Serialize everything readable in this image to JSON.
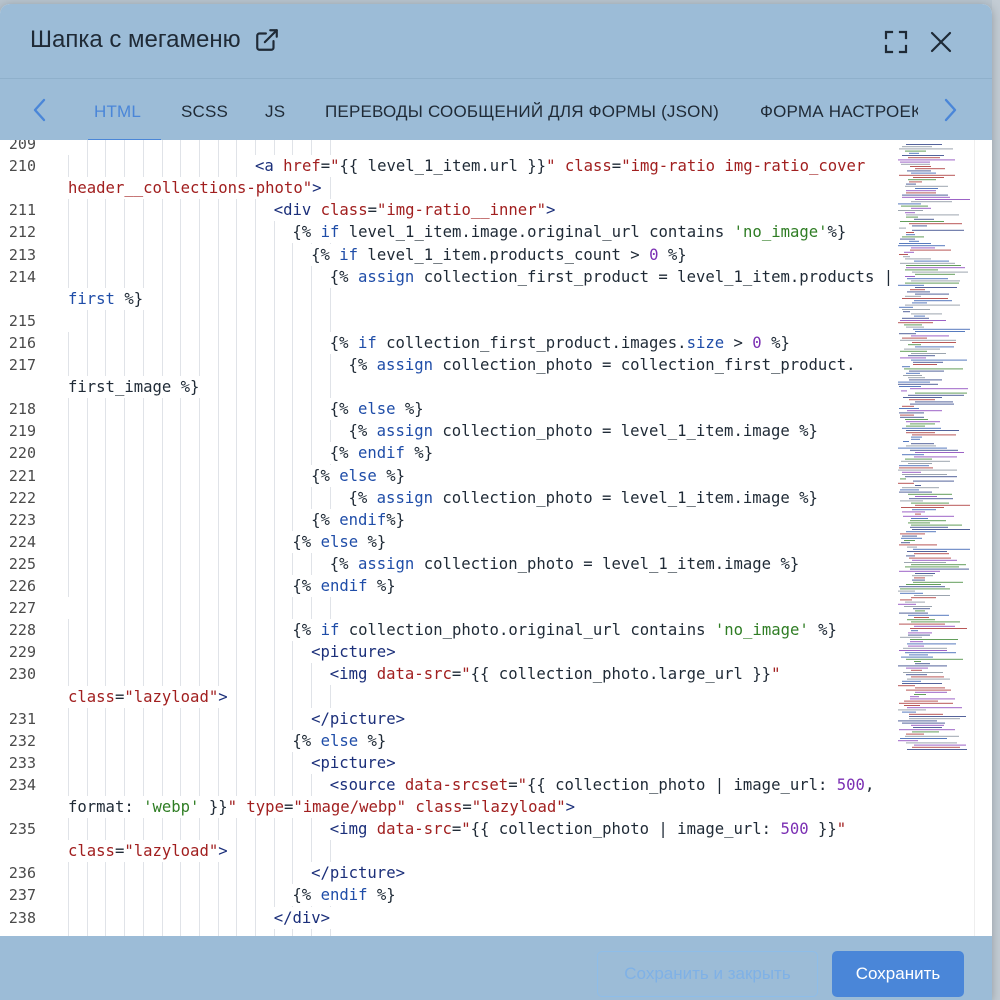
{
  "modal": {
    "title": "Шапка с мегаменю"
  },
  "tabs": [
    {
      "label": "HTML",
      "active": true
    },
    {
      "label": "SCSS",
      "active": false
    },
    {
      "label": "JS",
      "active": false
    },
    {
      "label": "ПЕРЕВОДЫ СООБЩЕНИЙ ДЛЯ ФОРМЫ (JSON)",
      "active": false
    },
    {
      "label": "ФОРМА НАСТРОЕК",
      "active": false
    }
  ],
  "colors": {
    "header_bg": "#9cbcd7",
    "accent": "#4a86d8",
    "tag": "#1b2f7a",
    "string": "#a11f1f",
    "keyword": "#1f4da8",
    "number": "#7b2fb3",
    "single_quote_string": "#2f7d24"
  },
  "icons": {
    "external": "external-link-icon",
    "fullscreen": "fullscreen-icon",
    "close": "close-icon",
    "prev": "chevron-left-icon",
    "next": "chevron-right-icon"
  },
  "editor": {
    "lines": [
      {
        "n": "209",
        "indent": 0,
        "tokens": []
      },
      {
        "n": "210",
        "indent": 10,
        "tokens": [
          [
            "tag",
            "<a"
          ],
          [
            "p",
            " "
          ],
          [
            "attr",
            "href"
          ],
          [
            "p",
            "="
          ],
          [
            "str",
            "\""
          ],
          [
            "p",
            "{{ level_1_item.url }}"
          ],
          [
            "str",
            "\""
          ],
          [
            "p",
            " "
          ],
          [
            "attr",
            "class"
          ],
          [
            "p",
            "="
          ],
          [
            "str",
            "\"img-ratio img-ratio_cover"
          ]
        ]
      },
      {
        "n": "",
        "indent": 0,
        "tokens": [
          [
            "str",
            "header__collections-photo\""
          ],
          [
            "tag",
            ">"
          ]
        ]
      },
      {
        "n": "211",
        "indent": 11,
        "tokens": [
          [
            "tag",
            "<div"
          ],
          [
            "p",
            " "
          ],
          [
            "attr",
            "class"
          ],
          [
            "p",
            "="
          ],
          [
            "str",
            "\"img-ratio__inner\""
          ],
          [
            "tag",
            ">"
          ]
        ]
      },
      {
        "n": "212",
        "indent": 12,
        "tokens": [
          [
            "p",
            "{%"
          ],
          [
            "p",
            " "
          ],
          [
            "kw",
            "if"
          ],
          [
            "p",
            " level_1_item.image.original_url contains "
          ],
          [
            "sq",
            "'no_image'"
          ],
          [
            "p",
            "%}"
          ]
        ]
      },
      {
        "n": "213",
        "indent": 13,
        "tokens": [
          [
            "p",
            "{%"
          ],
          [
            "p",
            " "
          ],
          [
            "kw",
            "if"
          ],
          [
            "p",
            " level_1_item.products_count > "
          ],
          [
            "num",
            "0"
          ],
          [
            "p",
            " %}"
          ]
        ]
      },
      {
        "n": "214",
        "indent": 14,
        "tokens": [
          [
            "p",
            "{%"
          ],
          [
            "p",
            " "
          ],
          [
            "kw",
            "assign"
          ],
          [
            "p",
            " collection_first_product = level_1_item.products |"
          ]
        ]
      },
      {
        "n": "",
        "indent": 0,
        "tokens": [
          [
            "kw",
            "first"
          ],
          [
            "p",
            " %}"
          ]
        ]
      },
      {
        "n": "215",
        "indent": 0,
        "tokens": []
      },
      {
        "n": "216",
        "indent": 14,
        "tokens": [
          [
            "p",
            "{%"
          ],
          [
            "p",
            " "
          ],
          [
            "kw",
            "if"
          ],
          [
            "p",
            " collection_first_product.images."
          ],
          [
            "kw",
            "size"
          ],
          [
            "p",
            " > "
          ],
          [
            "num",
            "0"
          ],
          [
            "p",
            " %}"
          ]
        ]
      },
      {
        "n": "217",
        "indent": 15,
        "tokens": [
          [
            "p",
            "{%"
          ],
          [
            "p",
            " "
          ],
          [
            "kw",
            "assign"
          ],
          [
            "p",
            " collection_photo = collection_first_product."
          ]
        ]
      },
      {
        "n": "",
        "indent": 0,
        "tokens": [
          [
            "p",
            "first_image %}"
          ]
        ]
      },
      {
        "n": "218",
        "indent": 14,
        "tokens": [
          [
            "p",
            "{%"
          ],
          [
            "p",
            " "
          ],
          [
            "kw",
            "else"
          ],
          [
            "p",
            " %}"
          ]
        ]
      },
      {
        "n": "219",
        "indent": 15,
        "tokens": [
          [
            "p",
            "{%"
          ],
          [
            "p",
            " "
          ],
          [
            "kw",
            "assign"
          ],
          [
            "p",
            " collection_photo = level_1_item.image %}"
          ]
        ]
      },
      {
        "n": "220",
        "indent": 14,
        "tokens": [
          [
            "p",
            "{%"
          ],
          [
            "p",
            " "
          ],
          [
            "kw",
            "endif"
          ],
          [
            "p",
            " %}"
          ]
        ]
      },
      {
        "n": "221",
        "indent": 13,
        "tokens": [
          [
            "p",
            "{%"
          ],
          [
            "p",
            " "
          ],
          [
            "kw",
            "else"
          ],
          [
            "p",
            " %}"
          ]
        ]
      },
      {
        "n": "222",
        "indent": 15,
        "tokens": [
          [
            "p",
            "{%"
          ],
          [
            "p",
            " "
          ],
          [
            "kw",
            "assign"
          ],
          [
            "p",
            " collection_photo = level_1_item.image %}"
          ]
        ]
      },
      {
        "n": "223",
        "indent": 13,
        "tokens": [
          [
            "p",
            "{%"
          ],
          [
            "p",
            " "
          ],
          [
            "kw",
            "endif"
          ],
          [
            "p",
            "%}"
          ]
        ]
      },
      {
        "n": "224",
        "indent": 12,
        "tokens": [
          [
            "p",
            "{%"
          ],
          [
            "p",
            " "
          ],
          [
            "kw",
            "else"
          ],
          [
            "p",
            " %}"
          ]
        ]
      },
      {
        "n": "225",
        "indent": 14,
        "tokens": [
          [
            "p",
            "{%"
          ],
          [
            "p",
            " "
          ],
          [
            "kw",
            "assign"
          ],
          [
            "p",
            " collection_photo = level_1_item.image %}"
          ]
        ]
      },
      {
        "n": "226",
        "indent": 12,
        "tokens": [
          [
            "p",
            "{%"
          ],
          [
            "p",
            " "
          ],
          [
            "kw",
            "endif"
          ],
          [
            "p",
            " %}"
          ]
        ]
      },
      {
        "n": "227",
        "indent": 0,
        "tokens": []
      },
      {
        "n": "228",
        "indent": 12,
        "tokens": [
          [
            "p",
            "{%"
          ],
          [
            "p",
            " "
          ],
          [
            "kw",
            "if"
          ],
          [
            "p",
            " collection_photo.original_url contains "
          ],
          [
            "sq",
            "'no_image'"
          ],
          [
            "p",
            " %}"
          ]
        ]
      },
      {
        "n": "229",
        "indent": 13,
        "tokens": [
          [
            "tag",
            "<picture>"
          ]
        ]
      },
      {
        "n": "230",
        "indent": 14,
        "tokens": [
          [
            "tag",
            "<img"
          ],
          [
            "p",
            " "
          ],
          [
            "attr",
            "data-src"
          ],
          [
            "p",
            "="
          ],
          [
            "str",
            "\""
          ],
          [
            "p",
            "{{ collection_photo.large_url }}"
          ],
          [
            "str",
            "\""
          ]
        ]
      },
      {
        "n": "",
        "indent": 0,
        "tokens": [
          [
            "attr",
            "class"
          ],
          [
            "p",
            "="
          ],
          [
            "str",
            "\"lazyload\""
          ],
          [
            "tag",
            ">"
          ]
        ]
      },
      {
        "n": "231",
        "indent": 13,
        "tokens": [
          [
            "tag",
            "</picture>"
          ]
        ]
      },
      {
        "n": "232",
        "indent": 12,
        "tokens": [
          [
            "p",
            "{%"
          ],
          [
            "p",
            " "
          ],
          [
            "kw",
            "else"
          ],
          [
            "p",
            " %}"
          ]
        ]
      },
      {
        "n": "233",
        "indent": 13,
        "tokens": [
          [
            "tag",
            "<picture>"
          ]
        ]
      },
      {
        "n": "234",
        "indent": 14,
        "tokens": [
          [
            "tag",
            "<source"
          ],
          [
            "p",
            " "
          ],
          [
            "attr",
            "data-srcset"
          ],
          [
            "p",
            "="
          ],
          [
            "str",
            "\""
          ],
          [
            "p",
            "{{ collection_photo | image_url: "
          ],
          [
            "num",
            "500"
          ],
          [
            "p",
            ","
          ]
        ]
      },
      {
        "n": "",
        "indent": 0,
        "tokens": [
          [
            "p",
            "format: "
          ],
          [
            "sq",
            "'webp'"
          ],
          [
            "p",
            " }}"
          ],
          [
            "str",
            "\""
          ],
          [
            "p",
            " "
          ],
          [
            "attr",
            "type"
          ],
          [
            "p",
            "="
          ],
          [
            "str",
            "\"image/webp\""
          ],
          [
            "p",
            " "
          ],
          [
            "attr",
            "class"
          ],
          [
            "p",
            "="
          ],
          [
            "str",
            "\"lazyload\""
          ],
          [
            "tag",
            ">"
          ]
        ]
      },
      {
        "n": "235",
        "indent": 14,
        "tokens": [
          [
            "tag",
            "<img"
          ],
          [
            "p",
            " "
          ],
          [
            "attr",
            "data-src"
          ],
          [
            "p",
            "="
          ],
          [
            "str",
            "\""
          ],
          [
            "p",
            "{{ collection_photo | image_url: "
          ],
          [
            "num",
            "500"
          ],
          [
            "p",
            " }}"
          ],
          [
            "str",
            "\""
          ]
        ]
      },
      {
        "n": "",
        "indent": 0,
        "tokens": [
          [
            "attr",
            "class"
          ],
          [
            "p",
            "="
          ],
          [
            "str",
            "\"lazyload\""
          ],
          [
            "tag",
            ">"
          ]
        ]
      },
      {
        "n": "236",
        "indent": 13,
        "tokens": [
          [
            "tag",
            "</picture>"
          ]
        ]
      },
      {
        "n": "237",
        "indent": 12,
        "tokens": [
          [
            "p",
            "{%"
          ],
          [
            "p",
            " "
          ],
          [
            "kw",
            "endif"
          ],
          [
            "p",
            " %}"
          ]
        ]
      },
      {
        "n": "238",
        "indent": 11,
        "tokens": [
          [
            "tag",
            "</div>"
          ]
        ]
      }
    ]
  },
  "footer": {
    "save_close_label": "Сохранить и закрыть",
    "save_label": "Сохранить"
  }
}
